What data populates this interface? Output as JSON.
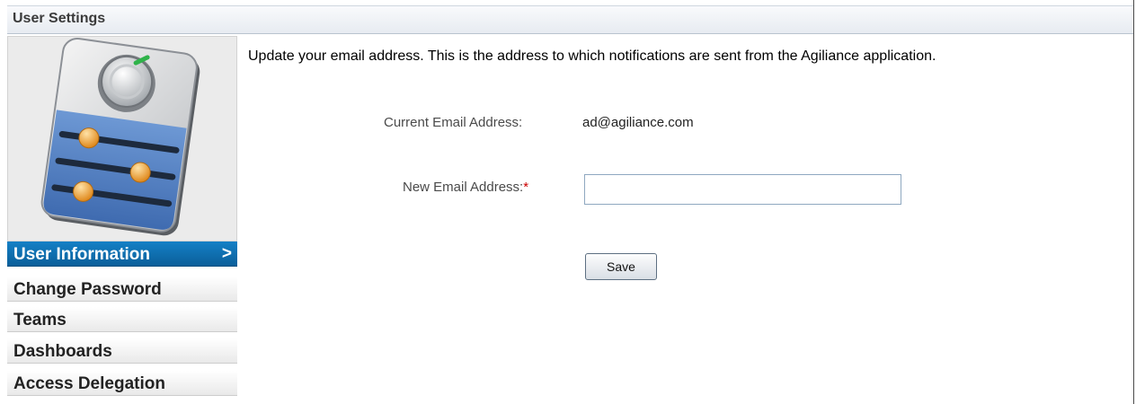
{
  "window": {
    "title": "User Settings"
  },
  "sidebar": {
    "graphic_icon": "settings-sliders-dial-icon",
    "items": [
      {
        "label": "User Information",
        "active": true
      },
      {
        "label": "Change Password",
        "active": false
      },
      {
        "label": "Teams",
        "active": false
      },
      {
        "label": "Dashboards",
        "active": false
      },
      {
        "label": "Access Delegation",
        "active": false
      }
    ],
    "active_chevron": ">"
  },
  "main": {
    "description": "Update your email address. This is the address to which notifications are sent from the Agiliance application.",
    "current_email_label": "Current Email Address:",
    "current_email_value": "ad@agiliance.com",
    "new_email_label": "New Email Address:",
    "required_marker": "*",
    "new_email_value": "",
    "save_label": "Save"
  },
  "colors": {
    "active_nav": "#0b6fb0",
    "required": "#cc0000",
    "graphic_blue": "#4f7fc2",
    "knob_orange": "#f2a23a"
  }
}
